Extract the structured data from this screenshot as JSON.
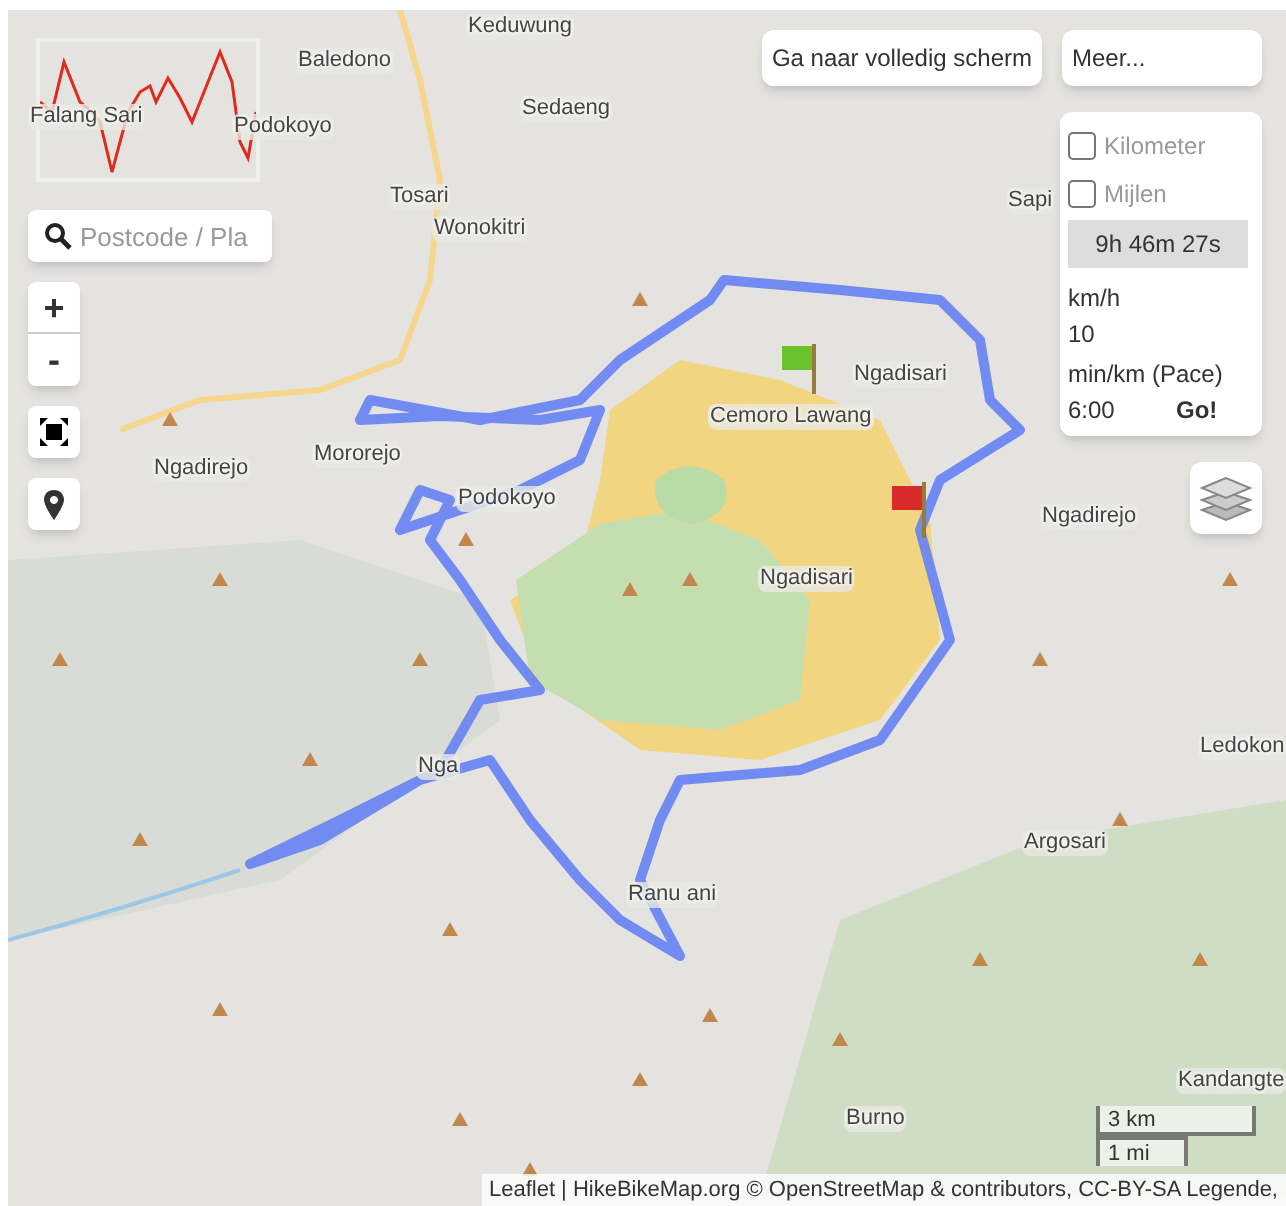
{
  "map_labels": [
    "Keduwung",
    "Baledono",
    "Sedaeng",
    "Falang Sari",
    "Podokoyo",
    "Tosari",
    "Wonokitri",
    "Sapi",
    "Ngadisari",
    "Cemoro Lawang",
    "Ngadirejo",
    "Mororejo",
    "Podokoyo",
    "Ngadisari",
    "Ngadirejo",
    "Ledokon",
    "Nga",
    "Argosari",
    "Ranu ani",
    "Kandangte",
    "Burno"
  ],
  "search": {
    "placeholder": "Postcode / Pla"
  },
  "zoom_buttons": [
    "+",
    "-"
  ],
  "top_buttons": [
    "Ga naar volledig scherm",
    "Meer..."
  ],
  "units": [
    {
      "label": "Kilometer",
      "checked": false
    },
    {
      "label": "Mijlen",
      "checked": false
    }
  ],
  "duration": "9h 46m 27s",
  "speed": {
    "label": "km/h",
    "value": "10"
  },
  "pace": {
    "label": "min/km (Pace)",
    "value": "6:00"
  },
  "go_button": "Go!",
  "scale": [
    "3 km",
    "1 mi"
  ],
  "attribution": {
    "link": "Leaflet",
    "text": "| HikeBikeMap.org © OpenStreetMap & contributors, CC-BY-SA Legende,"
  }
}
